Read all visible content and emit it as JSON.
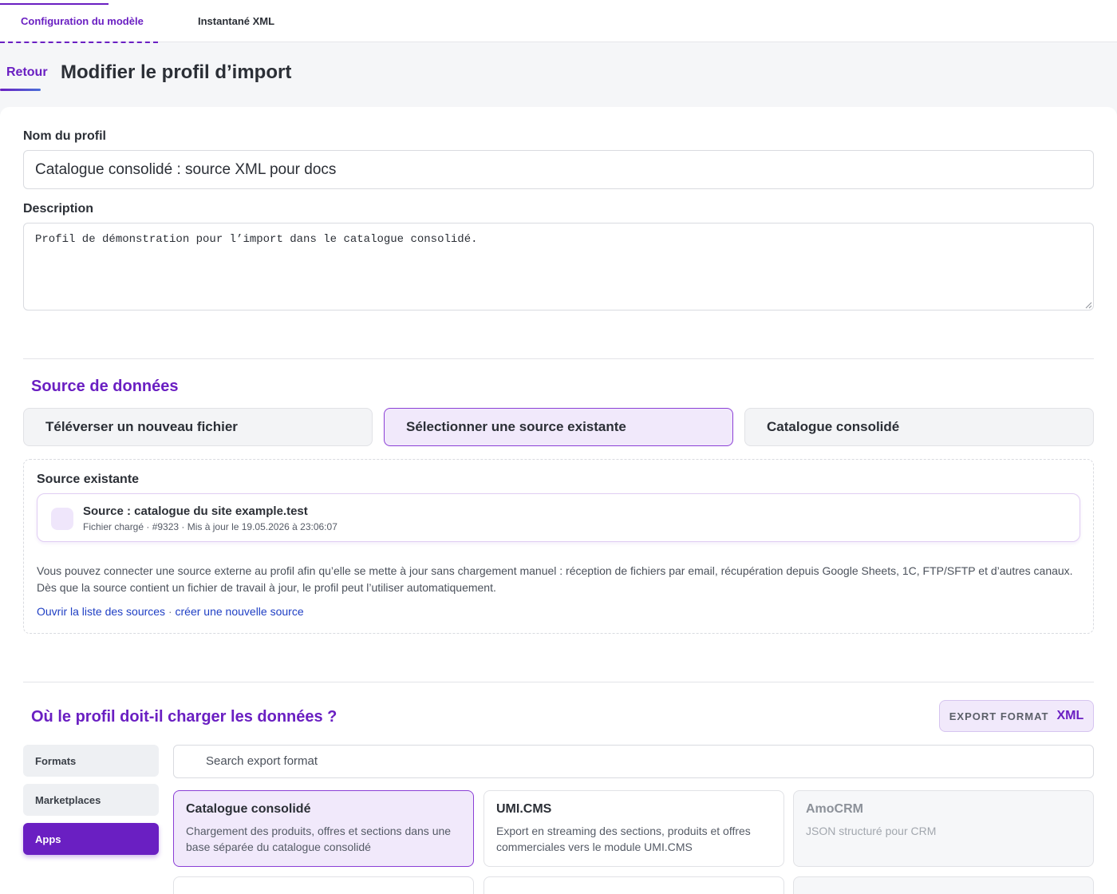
{
  "tabs": [
    {
      "label": "Configuration du modèle",
      "active": true
    },
    {
      "label": "Instantané XML",
      "active": false
    }
  ],
  "header": {
    "back_label": "Retour",
    "title": "Modifier le profil d’import"
  },
  "form": {
    "name_label": "Nom du profil",
    "name_value": "Catalogue consolidé : source XML pour docs",
    "description_label": "Description",
    "description_value": "Profil de démonstration pour l’import dans le catalogue consolidé."
  },
  "data_source": {
    "title": "Source de données",
    "options": [
      {
        "label": "Téléverser un nouveau fichier",
        "active": false
      },
      {
        "label": "Sélectionner une source existante",
        "active": true
      },
      {
        "label": "Catalogue consolidé",
        "active": false
      }
    ],
    "existing_label": "Source existante",
    "selected_source": {
      "title": "Source : catalogue du site example.test",
      "meta": "Fichier chargé · #9323 · Mis à jour le 19.05.2026 à 23:06:07"
    },
    "help_text": "Vous pouvez connecter une source externe au profil afin qu’elle se mette à jour sans chargement manuel : réception de fichiers par email, récupération depuis Google Sheets, 1C, FTP/SFTP et d’autres canaux. Dès que la source contient un fichier de travail à jour, le profil peut l’utiliser automatiquement.",
    "link_sources": "Ouvrir la liste des sources",
    "link_separator": " · ",
    "link_new": "créer une nouvelle source"
  },
  "destination": {
    "title": "Où le profil doit-il charger les données ?",
    "export_format_key": "EXPORT FORMAT",
    "export_format_value": "XML",
    "categories": [
      {
        "label": "Formats",
        "active": false
      },
      {
        "label": "Marketplaces",
        "active": false
      },
      {
        "label": "Apps",
        "active": true
      }
    ],
    "search_placeholder": "Search export format",
    "formats": [
      {
        "name": "Catalogue consolidé",
        "desc": "Chargement des produits, offres et sections dans une base séparée du catalogue consolidé",
        "state": "selected"
      },
      {
        "name": "UMI.CMS",
        "desc": "Export en streaming des sections, produits et offres commerciales vers le module UMI.CMS",
        "state": "normal"
      },
      {
        "name": "AmoCRM",
        "desc": "JSON structuré pour CRM",
        "state": "disabled"
      }
    ]
  },
  "colors": {
    "accent": "#6a1fc2",
    "accent_soft": "#f1e9fb",
    "link": "#1f3fc4"
  }
}
